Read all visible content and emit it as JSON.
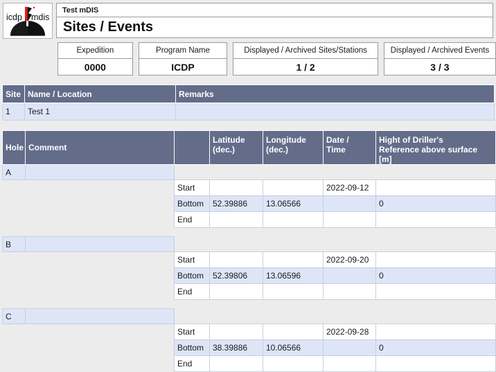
{
  "app": {
    "logo_left_text": "icdp",
    "logo_right_text": "mdis",
    "subtitle": "Test mDIS",
    "page_title": "Sites / Events"
  },
  "colors": {
    "header_slate": "#636d8a",
    "row_blue": "#dde5f7",
    "page_gray": "#ececec",
    "grid_line": "#c8cfdd",
    "logo_red": "#e01b12"
  },
  "info_boxes": [
    {
      "label": "Expedition",
      "value": "0000"
    },
    {
      "label": "Program Name",
      "value": "ICDP"
    },
    {
      "label": "Displayed / Archived Sites/Stations",
      "value": "1 / 2"
    },
    {
      "label": "Displayed / Archived Events",
      "value": "3 / 3"
    }
  ],
  "sites_table": {
    "columns": [
      "Site",
      "Name / Location",
      "Remarks"
    ],
    "rows": [
      {
        "site": "1",
        "name": "Test 1",
        "remarks": ""
      }
    ]
  },
  "holes_table": {
    "columns": [
      "Hole",
      "Comment",
      "",
      "Latitude (dec.)",
      "Longitude (dec.)",
      "Date / Time",
      "Hight of Driller's Reference above surface [m]"
    ],
    "column_lines": {
      "latitude_line1": "Latitude",
      "latitude_line2": "(dec.)",
      "longitude_line1": "Longitude",
      "longitude_line2": "(dec.)",
      "date_line1": "Date /",
      "date_line2": "Time",
      "height_line1": "Hight of Driller's",
      "height_line2": "Reference above surface",
      "height_line3": "[m]"
    },
    "holes": [
      {
        "hole": "A",
        "comment": "",
        "events": [
          {
            "type": "Start",
            "latitude": "",
            "longitude": "",
            "datetime": "2022-09-12",
            "height": ""
          },
          {
            "type": "Bottom",
            "latitude": "52.39886",
            "longitude": "13.06566",
            "datetime": "",
            "height": "0"
          },
          {
            "type": "End",
            "latitude": "",
            "longitude": "",
            "datetime": "",
            "height": ""
          }
        ]
      },
      {
        "hole": "B",
        "comment": "",
        "events": [
          {
            "type": "Start",
            "latitude": "",
            "longitude": "",
            "datetime": "2022-09-20",
            "height": ""
          },
          {
            "type": "Bottom",
            "latitude": "52.39806",
            "longitude": "13.06596",
            "datetime": "",
            "height": "0"
          },
          {
            "type": "End",
            "latitude": "",
            "longitude": "",
            "datetime": "",
            "height": ""
          }
        ]
      },
      {
        "hole": "C",
        "comment": "",
        "events": [
          {
            "type": "Start",
            "latitude": "",
            "longitude": "",
            "datetime": "2022-09-28",
            "height": ""
          },
          {
            "type": "Bottom",
            "latitude": "38.39886",
            "longitude": "10.06566",
            "datetime": "",
            "height": "0"
          },
          {
            "type": "End",
            "latitude": "",
            "longitude": "",
            "datetime": "",
            "height": ""
          }
        ]
      }
    ]
  }
}
